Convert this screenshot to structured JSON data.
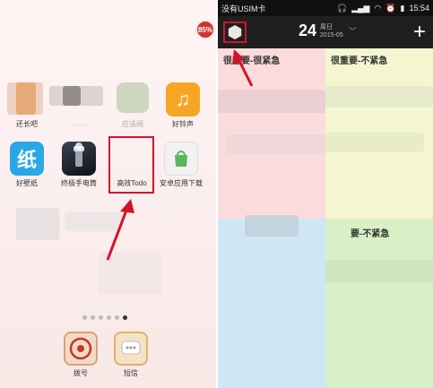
{
  "home": {
    "battery_badge": "85%",
    "row1_labels": [
      "还长吧",
      "……",
      "应该阅",
      "好铃声"
    ],
    "apps": [
      {
        "label": "好壁纸",
        "icon": "wallpaper-icon",
        "glyph": "纸"
      },
      {
        "label": "终极手电筒",
        "icon": "flashlight-icon"
      },
      {
        "label": "高效Todo",
        "icon": "todo-grid-icon"
      },
      {
        "label": "安卓应用下载",
        "icon": "store-icon"
      }
    ],
    "music_glyph": "♫",
    "dock": [
      {
        "label": "拨号",
        "icon": "phone-dial-icon"
      },
      {
        "label": "短信",
        "icon": "sms-icon"
      }
    ],
    "page_dots": 6,
    "active_dot": 5
  },
  "todo": {
    "status": {
      "carrier": "没有USIM卡",
      "icons": [
        "headset-icon",
        "signal-icon",
        "wifi-icon",
        "alarm-icon",
        "battery-icon"
      ],
      "time": "15:54"
    },
    "date": {
      "day": "24",
      "weekday": "周日",
      "month": "2015-05"
    },
    "add_label": "+",
    "quadrants": [
      {
        "title": "很重要-很紧急",
        "color": "#fbdcdc"
      },
      {
        "title": "很重要-不紧急",
        "color": "#f3f6cf"
      },
      {
        "title": "",
        "color": "#cfe7f5"
      },
      {
        "title": "要-不紧急",
        "color": "#d8f0c6"
      }
    ]
  }
}
